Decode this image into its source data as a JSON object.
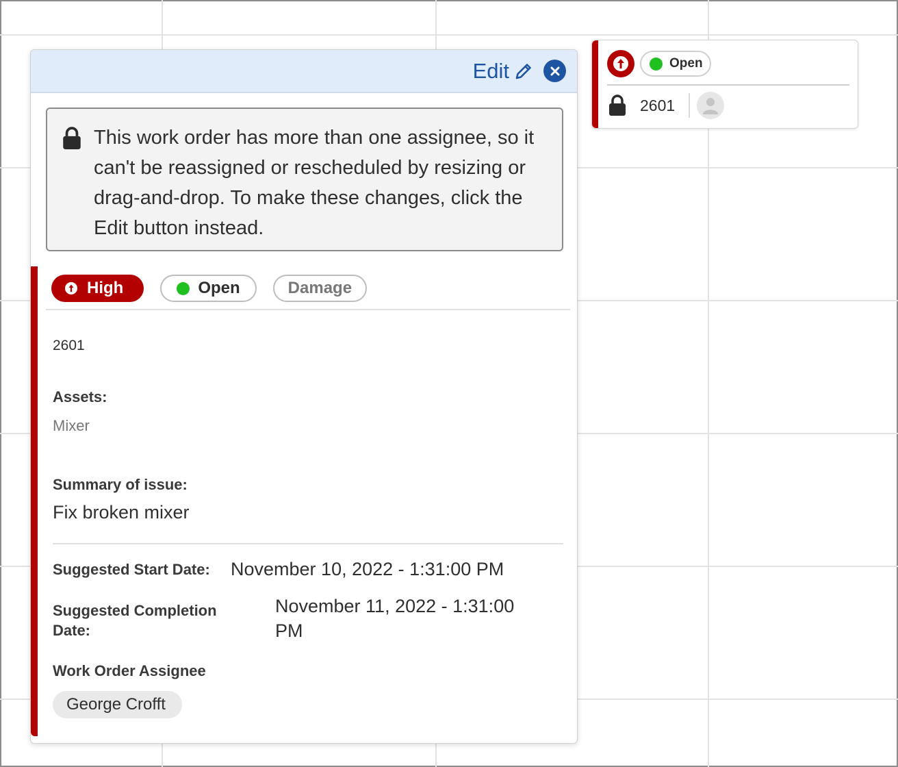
{
  "event_card": {
    "status": "Open",
    "work_order_id": "2601",
    "colors": {
      "priority": "#b30000",
      "status_dot": "#21c021"
    }
  },
  "popup": {
    "header": {
      "edit_label": "Edit"
    },
    "notice": "This work order has more than one assignee, so it can't be reassigned or rescheduled by resizing or drag-and-drop. To make these changes, click the Edit button instead.",
    "badges": {
      "priority": "High",
      "status": "Open",
      "category": "Damage"
    },
    "work_order_id": "2601",
    "assets": {
      "label": "Assets:",
      "value": "Mixer"
    },
    "summary": {
      "label": "Summary of issue:",
      "value": "Fix broken mixer"
    },
    "start_date": {
      "label": "Suggested Start Date:",
      "value": "November 10, 2022 - 1:31:00 PM"
    },
    "completion_date": {
      "label_line1": "Suggested Completion",
      "label_line2": "Date:",
      "value_line1": "November 11, 2022 - 1:31:00",
      "value_line2": "PM"
    },
    "assignee": {
      "label": "Work Order Assignee",
      "value": "George Crofft"
    }
  }
}
